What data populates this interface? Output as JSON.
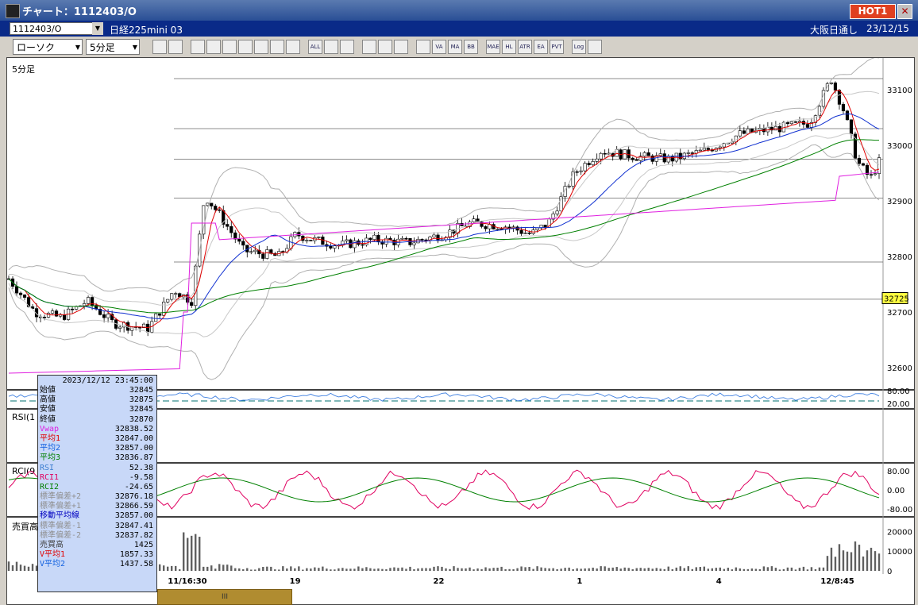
{
  "window": {
    "title": "チャート：1112403/O",
    "hot_label": "HOT1",
    "close_glyph": "✕"
  },
  "info_bar": {
    "code": "1112403/O",
    "name": "日経225mini 03",
    "exchange": "大阪日通し",
    "date": "23/12/15"
  },
  "toolbar": {
    "chart_type": "ローソク",
    "interval": "5分足",
    "buttons": [
      "zoom",
      "cursor",
      "bar",
      "candle",
      "line",
      "pnf",
      "ruler",
      "high-low",
      "candle2",
      "all",
      "pen",
      "arrow",
      "undo",
      "fan",
      "cross",
      "wave",
      "va",
      "ma",
      "bb",
      "mae",
      "hl",
      "atr",
      "ea",
      "pvt",
      "log",
      "export"
    ],
    "button_labels": {
      "all": "ALL",
      "va": "VA",
      "ma": "MA",
      "bb": "BB",
      "mae": "MAE",
      "hl": "HL",
      "atr": "ATR",
      "ea": "EA",
      "pvt": "PVT",
      "log": "Log"
    }
  },
  "panels": {
    "price": {
      "label": "5分足",
      "yticks": [
        "33100",
        "33000",
        "32900",
        "32800",
        "32700",
        "32600"
      ],
      "current_price": "32725"
    },
    "rsi": {
      "label": "RSI(1",
      "yticks": [
        "80.00",
        "20.00"
      ]
    },
    "rci": {
      "label": "RCI(9",
      "yticks": [
        "80.00",
        "0.00",
        "-80.00"
      ]
    },
    "volume": {
      "label": "売買高",
      "yticks": [
        "20000",
        "10000",
        "0"
      ]
    }
  },
  "xaxis": [
    "11/16:30",
    "19",
    "22",
    "1",
    "4",
    "12/8:45"
  ],
  "scroll_label": "III",
  "info_panel": {
    "datetime": "2023/12/12  23:45:00",
    "rows": [
      {
        "label": "始値",
        "value": "32845",
        "color": "#000000"
      },
      {
        "label": "高値",
        "value": "32875",
        "color": "#000000"
      },
      {
        "label": "安値",
        "value": "32845",
        "color": "#000000"
      },
      {
        "label": "終値",
        "value": "32870",
        "color": "#000000"
      },
      {
        "label": "Vwap",
        "value": "32838.52",
        "color": "#e020e0"
      },
      {
        "label": "平均1",
        "value": "32847.00",
        "color": "#e00000"
      },
      {
        "label": "平均2",
        "value": "32857.00",
        "color": "#1060e0"
      },
      {
        "label": "平均3",
        "value": "32836.87",
        "color": "#008000"
      },
      {
        "label": "RSI",
        "value": "52.38",
        "color": "#4080d0"
      },
      {
        "label": "RCI1",
        "value": "-9.58",
        "color": "#e00060"
      },
      {
        "label": "RCI2",
        "value": "-24.65",
        "color": "#008000"
      },
      {
        "label": "標準偏差+2",
        "value": "32876.18",
        "color": "#909090"
      },
      {
        "label": "標準偏差+1",
        "value": "32866.59",
        "color": "#909090"
      },
      {
        "label": "移動平均線",
        "value": "32857.00",
        "color": "#0000c0"
      },
      {
        "label": "標準偏差-1",
        "value": "32847.41",
        "color": "#909090"
      },
      {
        "label": "標準偏差-2",
        "value": "32837.82",
        "color": "#909090"
      },
      {
        "label": "売買高",
        "value": "1425",
        "color": "#404040"
      },
      {
        "label": "V平均1",
        "value": "1857.33",
        "color": "#e00000"
      },
      {
        "label": "V平均2",
        "value": "1437.58",
        "color": "#1060e0"
      }
    ]
  },
  "chart_data": {
    "type": "candlestick",
    "title": "",
    "x": [
      "11/16:30",
      "19",
      "22",
      "1",
      "4",
      "12/8:45"
    ],
    "close_path": [
      [
        0,
        32760
      ],
      [
        0.03,
        32700
      ],
      [
        0.06,
        32690
      ],
      [
        0.09,
        32720
      ],
      [
        0.12,
        32680
      ],
      [
        0.16,
        32670
      ],
      [
        0.19,
        32740
      ],
      [
        0.21,
        32720
      ],
      [
        0.225,
        32910
      ],
      [
        0.24,
        32880
      ],
      [
        0.27,
        32810
      ],
      [
        0.31,
        32800
      ],
      [
        0.33,
        32840
      ],
      [
        0.35,
        32830
      ],
      [
        0.38,
        32820
      ],
      [
        0.42,
        32830
      ],
      [
        0.46,
        32825
      ],
      [
        0.5,
        32840
      ],
      [
        0.53,
        32860
      ],
      [
        0.57,
        32855
      ],
      [
        0.6,
        32840
      ],
      [
        0.62,
        32860
      ],
      [
        0.65,
        32950
      ],
      [
        0.68,
        32990
      ],
      [
        0.72,
        32980
      ],
      [
        0.76,
        32975
      ],
      [
        0.8,
        32990
      ],
      [
        0.84,
        33020
      ],
      [
        0.88,
        33030
      ],
      [
        0.92,
        33040
      ],
      [
        0.945,
        33120
      ],
      [
        0.96,
        33060
      ],
      [
        0.975,
        32970
      ],
      [
        0.99,
        32940
      ],
      [
        1.0,
        32970
      ]
    ],
    "ylim": [
      32560,
      33140
    ],
    "rsi_ylim": [
      0,
      100
    ],
    "rci_ylim": [
      -100,
      100
    ],
    "volume_ylim": [
      0,
      25000
    ],
    "current_price": 32725
  }
}
